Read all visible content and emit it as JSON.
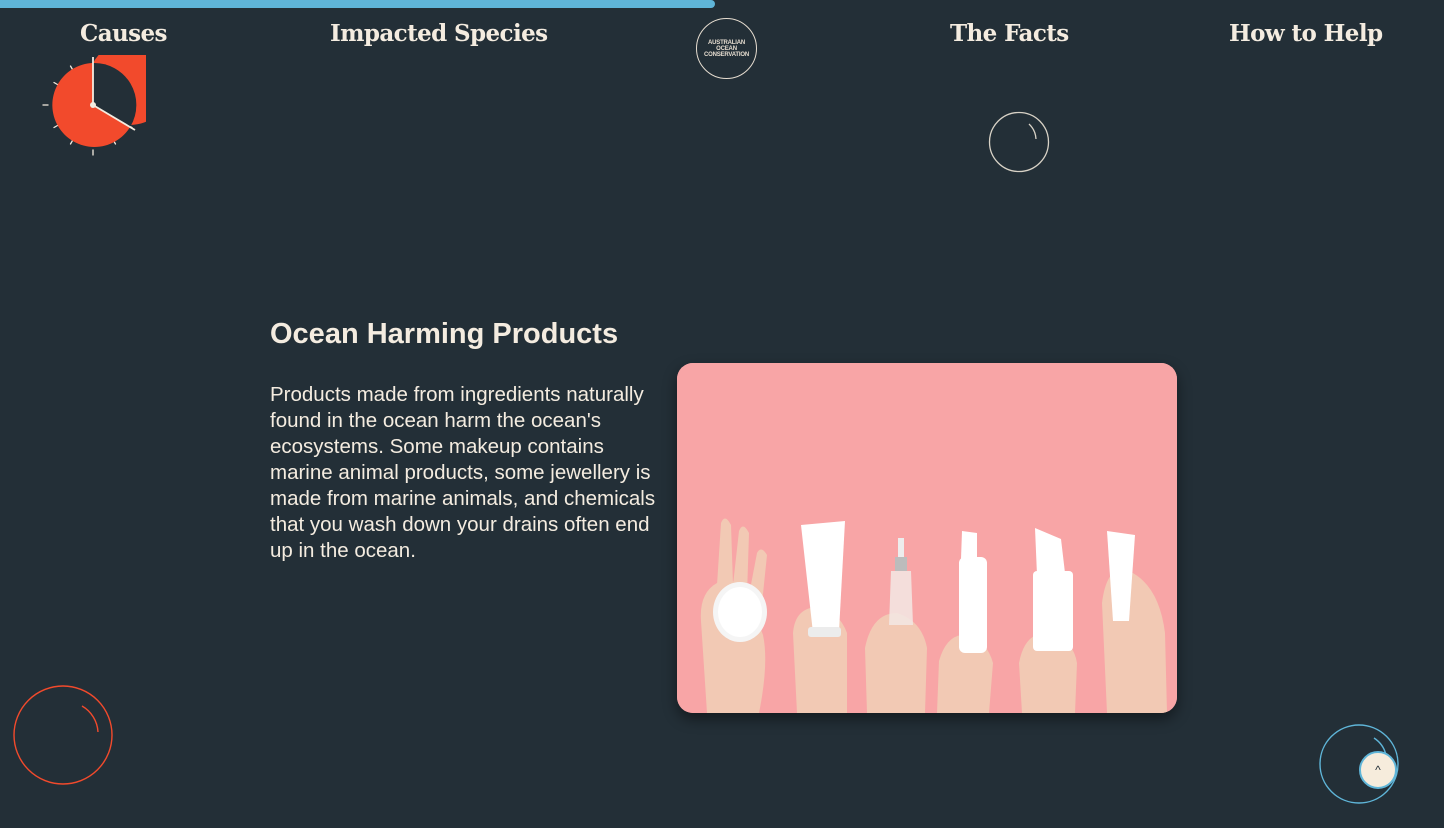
{
  "scroll_progress": 0.495,
  "colors": {
    "background": "#232f37",
    "text": "#f4ece0",
    "progress": "#5fb5d8",
    "accent_red": "#f24a2c",
    "image_background": "#f8a5a6"
  },
  "nav": {
    "causes": "Causes",
    "impacted_species": "Impacted Species",
    "the_facts": "The Facts",
    "how_to_help": "How to Help"
  },
  "logo": {
    "line1": "AUSTRALIAN",
    "line2": "OCEAN",
    "line3": "CONSERVATION"
  },
  "section": {
    "title": "Ocean Harming Products",
    "body": "Products made from ingredients naturally found in the ocean harm the ocean's ecosystems. Some makeup contains marine animal products, some jewellery is made from marine animals, and chemicals that you wash down your drains often end up in the ocean."
  },
  "icons": {
    "clock": "clock-timer-icon",
    "loading": "loading-spinner-icon",
    "back_to_top": "caret-up-icon"
  },
  "back_to_top": {
    "label": "^"
  }
}
